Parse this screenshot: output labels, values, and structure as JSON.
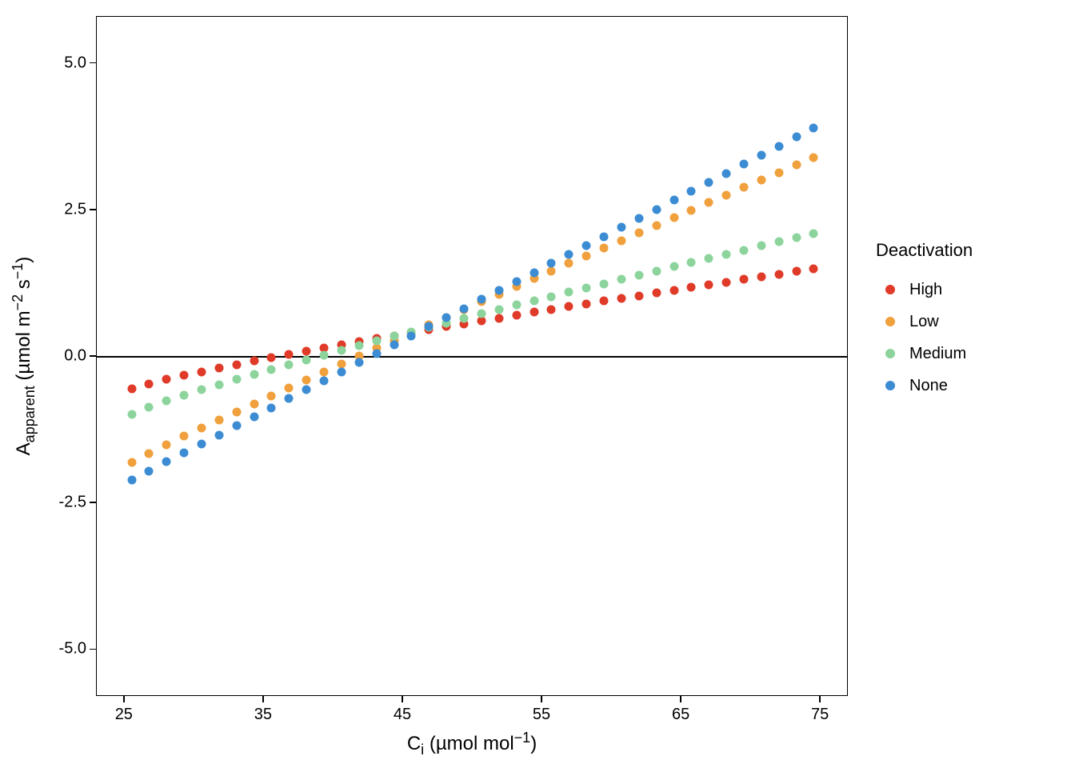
{
  "chart_data": {
    "type": "scatter",
    "title": "",
    "xlabel_html": "C<sub>i</sub> (µmol mol<sup>−1</sup>)",
    "ylabel_html": "A<sub>apparent</sub> (µmol m<sup>−2</sup> s<sup>−1</sup>)",
    "xlim": [
      23,
      77
    ],
    "ylim": [
      -5.8,
      5.8
    ],
    "xticks": [
      25,
      35,
      45,
      55,
      65,
      75
    ],
    "yticks": [
      -5.0,
      -2.5,
      0.0,
      2.5,
      5.0
    ],
    "ytick_labels": [
      "-5.0",
      "-2.5",
      "0.0",
      "2.5",
      "5.0"
    ],
    "hline": 0,
    "legend_title": "Deactivation",
    "legend_order": [
      "High",
      "Low",
      "Medium",
      "None"
    ],
    "colors": {
      "High": "#E03A28",
      "Low": "#F0A03C",
      "Medium": "#8CD49C",
      "None": "#3C8CD4"
    },
    "n_points": 40,
    "x_start": 25.5,
    "x_end": 74.5,
    "series": [
      {
        "name": "High",
        "x_start": 25.5,
        "x_end": 74.5,
        "y_start": -0.55,
        "y_end": 1.5
      },
      {
        "name": "Low",
        "x_start": 25.5,
        "x_end": 74.5,
        "y_start": -1.8,
        "y_end": 3.4
      },
      {
        "name": "Medium",
        "x_start": 25.5,
        "x_end": 74.5,
        "y_start": -0.98,
        "y_end": 2.1
      },
      {
        "name": "None",
        "x_start": 25.5,
        "x_end": 74.5,
        "y_start": -2.1,
        "y_end": 3.9
      }
    ]
  }
}
